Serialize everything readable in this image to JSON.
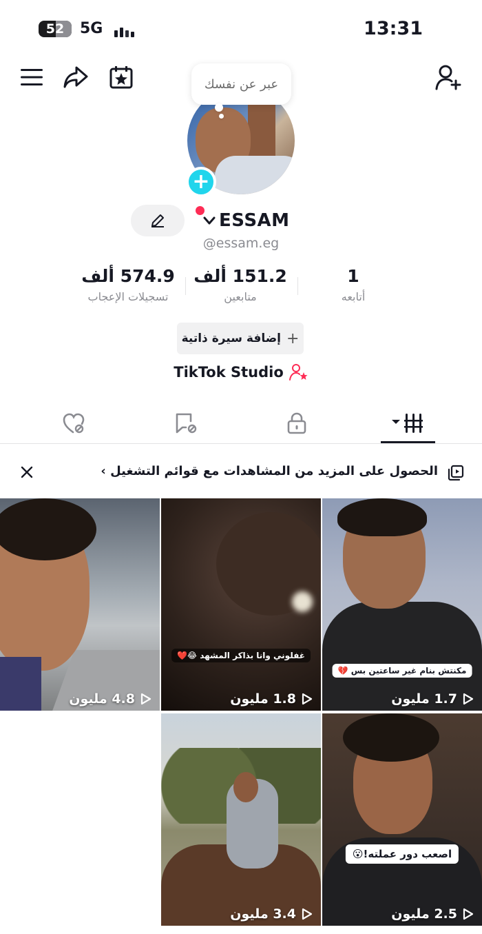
{
  "status_bar": {
    "battery": "52",
    "battery_level": 0.52,
    "network": "5G",
    "time": "13:31"
  },
  "header": {
    "menu_icon": "menu-icon",
    "share_icon": "share-icon",
    "calendar_icon": "calendar-star-icon",
    "add_friend_icon": "add-user-icon"
  },
  "profile": {
    "bubble_text": "عبر عن نفسك",
    "name": "ESSAM",
    "handle": "@essam.eg",
    "add_bio_label": "إضافة سيرة ذاتية",
    "studio_label": "TikTok Studio"
  },
  "stats": {
    "following": {
      "value": "1",
      "label": "أتابعه"
    },
    "followers": {
      "value": "151.2 ألف",
      "label": "متابعين"
    },
    "likes": {
      "value": "574.9 ألف",
      "label": "تسجيلات الإعجاب"
    }
  },
  "tabs": [
    {
      "name": "videos",
      "icon": "grid-icon",
      "active": true
    },
    {
      "name": "private",
      "icon": "lock-icon",
      "active": false
    },
    {
      "name": "reposts",
      "icon": "repost-icon",
      "active": false
    },
    {
      "name": "liked",
      "icon": "liked-icon",
      "active": false
    }
  ],
  "banner": {
    "text": "الحصول على المزيد من المشاهدات مع قوائم التشغيل ›"
  },
  "videos": [
    {
      "views": "1.7 مليون",
      "caption": "مكنتش بنام غير ساعتين بس 💔"
    },
    {
      "views": "1.8 مليون",
      "caption": "غفلوني وانا بذاكر المشهد 😂❤️"
    },
    {
      "views": "4.8 مليون",
      "caption": ""
    },
    {
      "views": "2.5 مليون",
      "caption": "اصعب دور عملته!😮"
    },
    {
      "views": "3.4 مليون",
      "caption": ""
    }
  ],
  "colors": {
    "accent_red": "#fe2c55",
    "accent_cyan": "#20d5ec",
    "text_primary": "#161823",
    "text_secondary": "#8a8b91"
  }
}
